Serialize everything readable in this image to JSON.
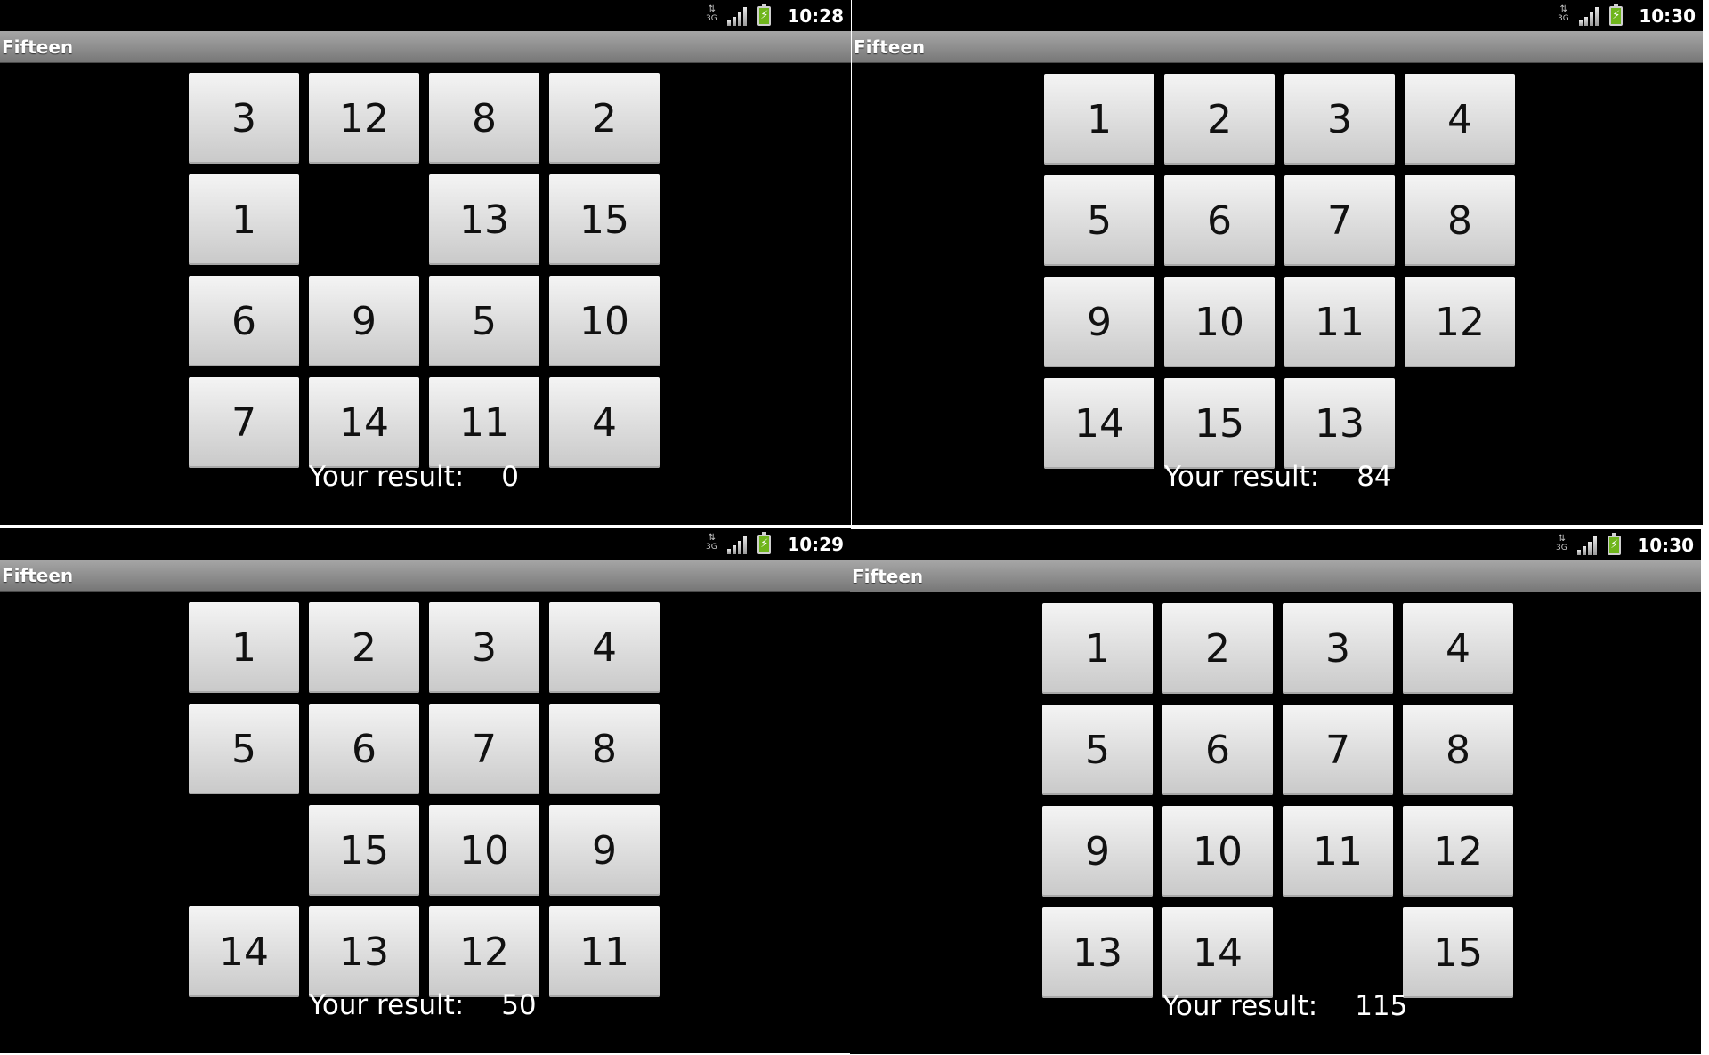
{
  "screens": [
    {
      "time": "10:28",
      "title": "Fifteen",
      "tiles": [
        "3",
        "12",
        "8",
        "2",
        "1",
        "",
        "13",
        "15",
        "6",
        "9",
        "5",
        "10",
        "7",
        "14",
        "11",
        "4"
      ],
      "result_label": "Your result:",
      "result_value": "0"
    },
    {
      "time": "10:30",
      "title": "Fifteen",
      "tiles": [
        "1",
        "2",
        "3",
        "4",
        "5",
        "6",
        "7",
        "8",
        "9",
        "10",
        "11",
        "12",
        "14",
        "15",
        "13",
        ""
      ],
      "result_label": "Your result:",
      "result_value": "84"
    },
    {
      "time": "10:29",
      "title": "Fifteen",
      "tiles": [
        "1",
        "2",
        "3",
        "4",
        "5",
        "6",
        "7",
        "8",
        "",
        "15",
        "10",
        "9",
        "14",
        "13",
        "12",
        "11"
      ],
      "result_label": "Your result:",
      "result_value": "50"
    },
    {
      "time": "10:30",
      "title": "Fifteen",
      "tiles": [
        "1",
        "2",
        "3",
        "4",
        "5",
        "6",
        "7",
        "8",
        "9",
        "10",
        "11",
        "12",
        "13",
        "14",
        "",
        "15"
      ],
      "result_label": "Your result:",
      "result_value": "115"
    }
  ],
  "icons": {
    "network": "3g-data-icon",
    "signal": "signal-strength-icon",
    "battery": "battery-charging-icon"
  },
  "network_label": "3G",
  "colors": {
    "background": "#000000",
    "titlebar": "#8d8d8d",
    "tile": "#dcdcdc",
    "battery": "#6fb51c"
  }
}
